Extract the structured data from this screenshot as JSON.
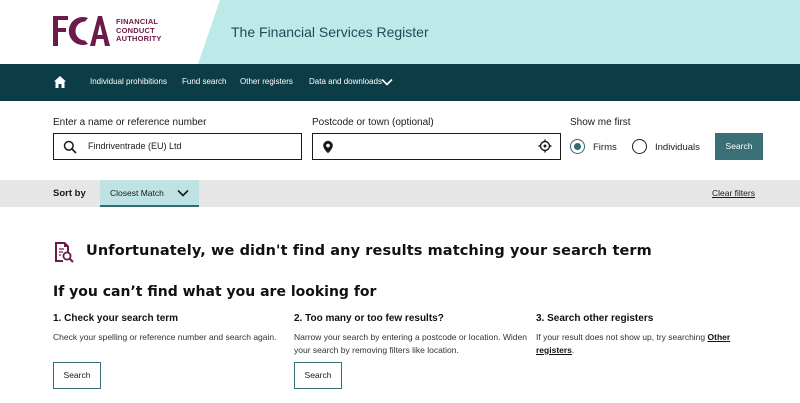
{
  "header": {
    "logo_letters": "FCA",
    "logo_lines": [
      "FINANCIAL",
      "CONDUCT",
      "AUTHORITY"
    ],
    "title": "The Financial Services Register",
    "band_color": "#bde9e8",
    "brand_color": "#6b1a4a"
  },
  "nav": {
    "bg_color": "#0c3d46",
    "home_icon": "home-icon",
    "items": [
      {
        "label": "Individual prohibitions"
      },
      {
        "label": "Fund search"
      },
      {
        "label": "Other registers"
      },
      {
        "label": "Data and downloads"
      }
    ]
  },
  "search": {
    "name_label": "Enter a name or reference number",
    "name_value": "Findriventrade (EU) Ltd",
    "postcode_label": "Postcode or town (optional)",
    "postcode_value": "",
    "show_first_label": "Show me first",
    "options": [
      {
        "label": "Firms",
        "selected": true
      },
      {
        "label": "Individuals",
        "selected": false
      }
    ],
    "button_label": "Search",
    "button_color": "#3a6f78"
  },
  "sort": {
    "label": "Sort by",
    "selected": "Closest Match",
    "clear_label": "Clear filters"
  },
  "results": {
    "no_results_message": "Unfortunately, we didn't find any results matching your search term",
    "help_title": "If you can’t find what you are looking for",
    "columns": [
      {
        "heading": "1. Check your search term",
        "text": "Check your spelling or reference number and search again.",
        "button_label": "Search"
      },
      {
        "heading": "2. Too many or too few results?",
        "text": "Narrow your search by entering a postcode or location. Widen your search by removing filters like location.",
        "button_label": "Search"
      },
      {
        "heading": "3. Search other registers",
        "text_before": "If your result does not show up, try searching ",
        "link_text": "Other registers",
        "text_after": "."
      }
    ]
  }
}
